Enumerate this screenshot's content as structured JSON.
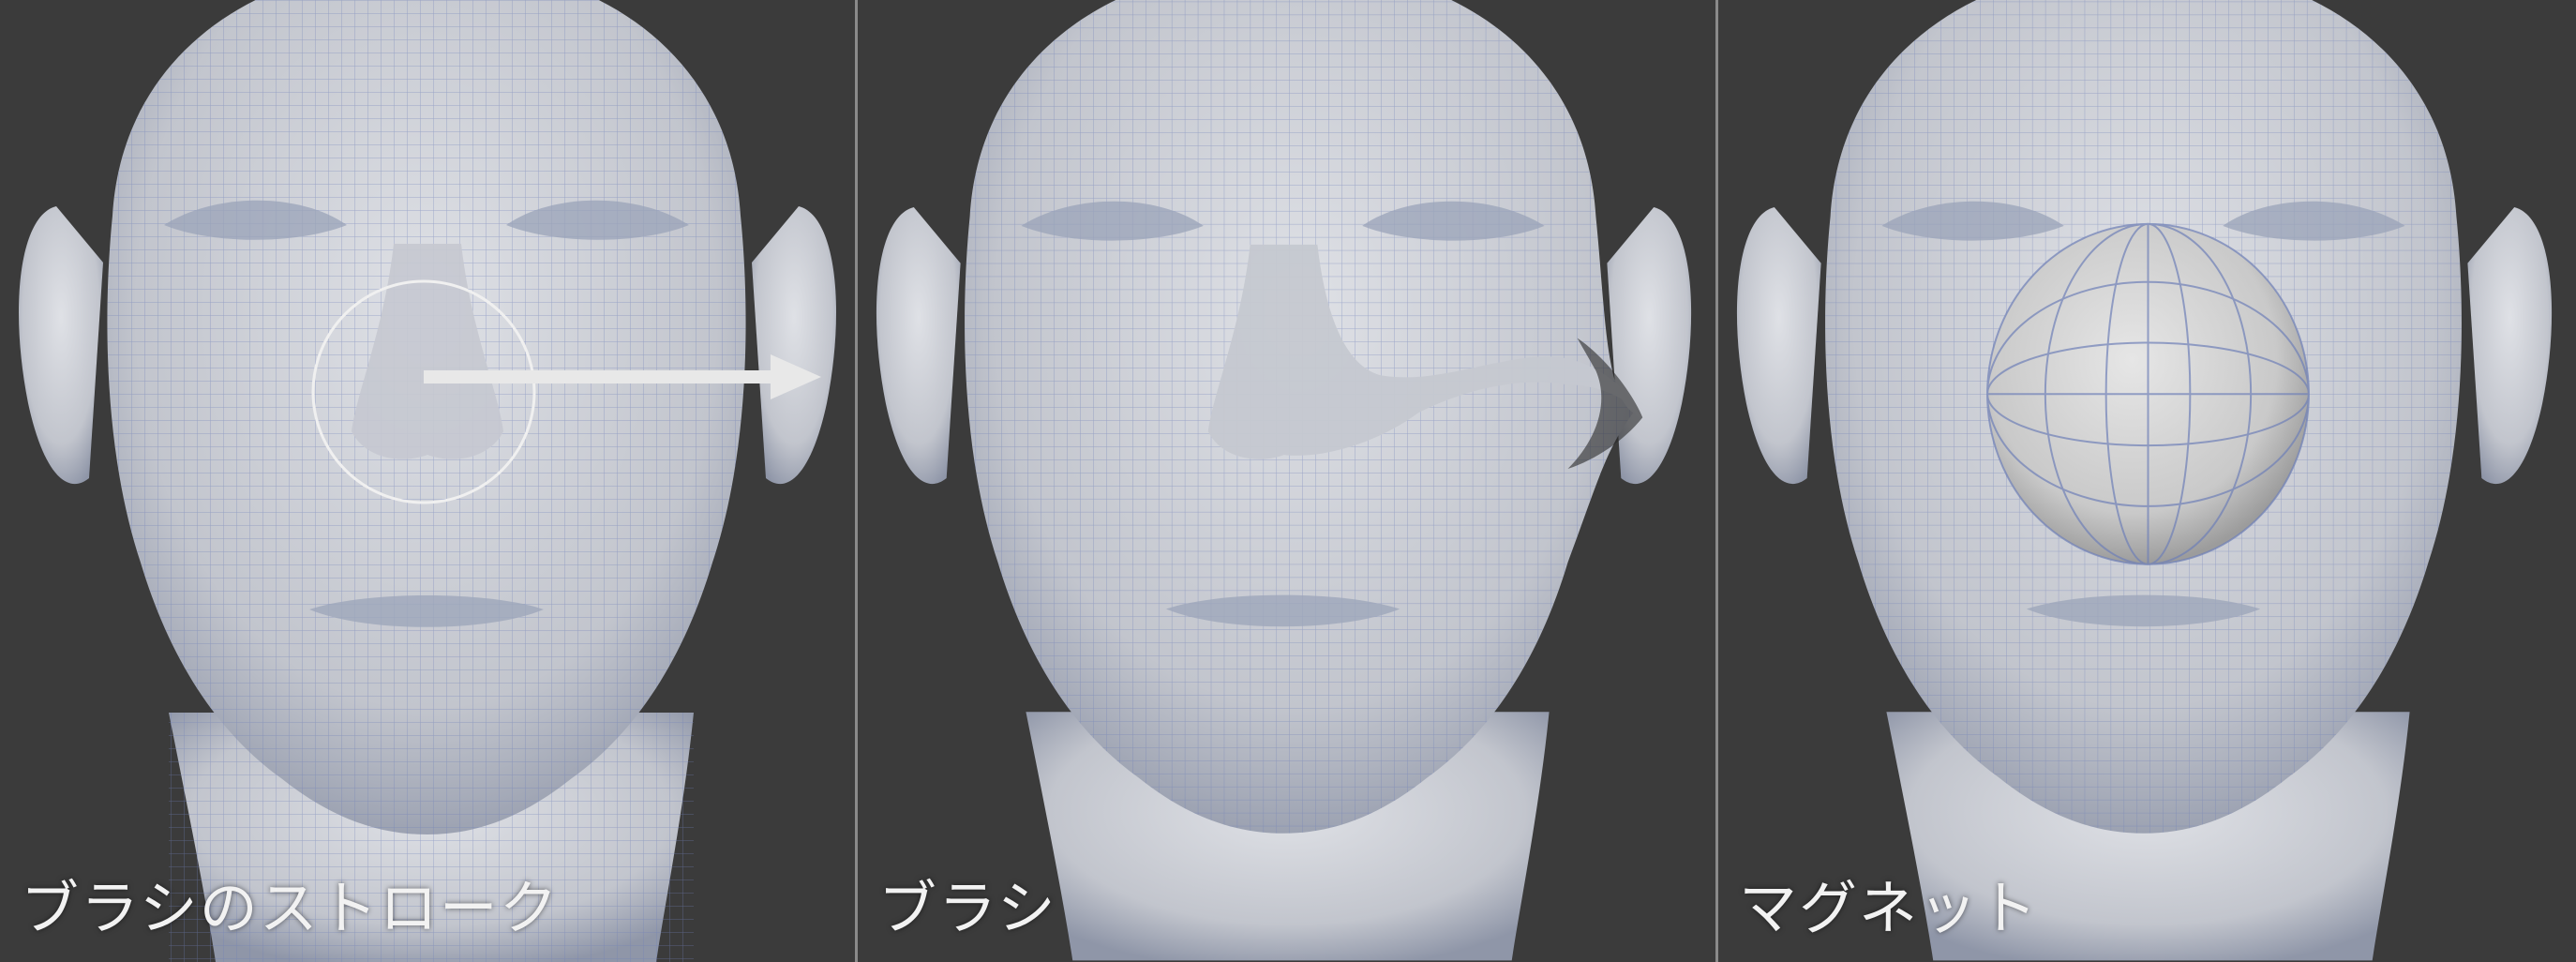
{
  "panels": [
    {
      "id": "stroke",
      "caption": "ブラシのストローク"
    },
    {
      "id": "brush",
      "caption": "ブラシ"
    },
    {
      "id": "magnet",
      "caption": "マグネット"
    }
  ],
  "colors": {
    "background": "#3b3b3b",
    "divider": "#8a8a8a",
    "skin": "#cfd2d8",
    "wire": "#6f80b8",
    "caption": "#f2f2f2",
    "arrow": "#e8e8e8"
  },
  "icons": {
    "brush_circle": "brush-radius-circle",
    "arrow": "stroke-direction-arrow"
  }
}
